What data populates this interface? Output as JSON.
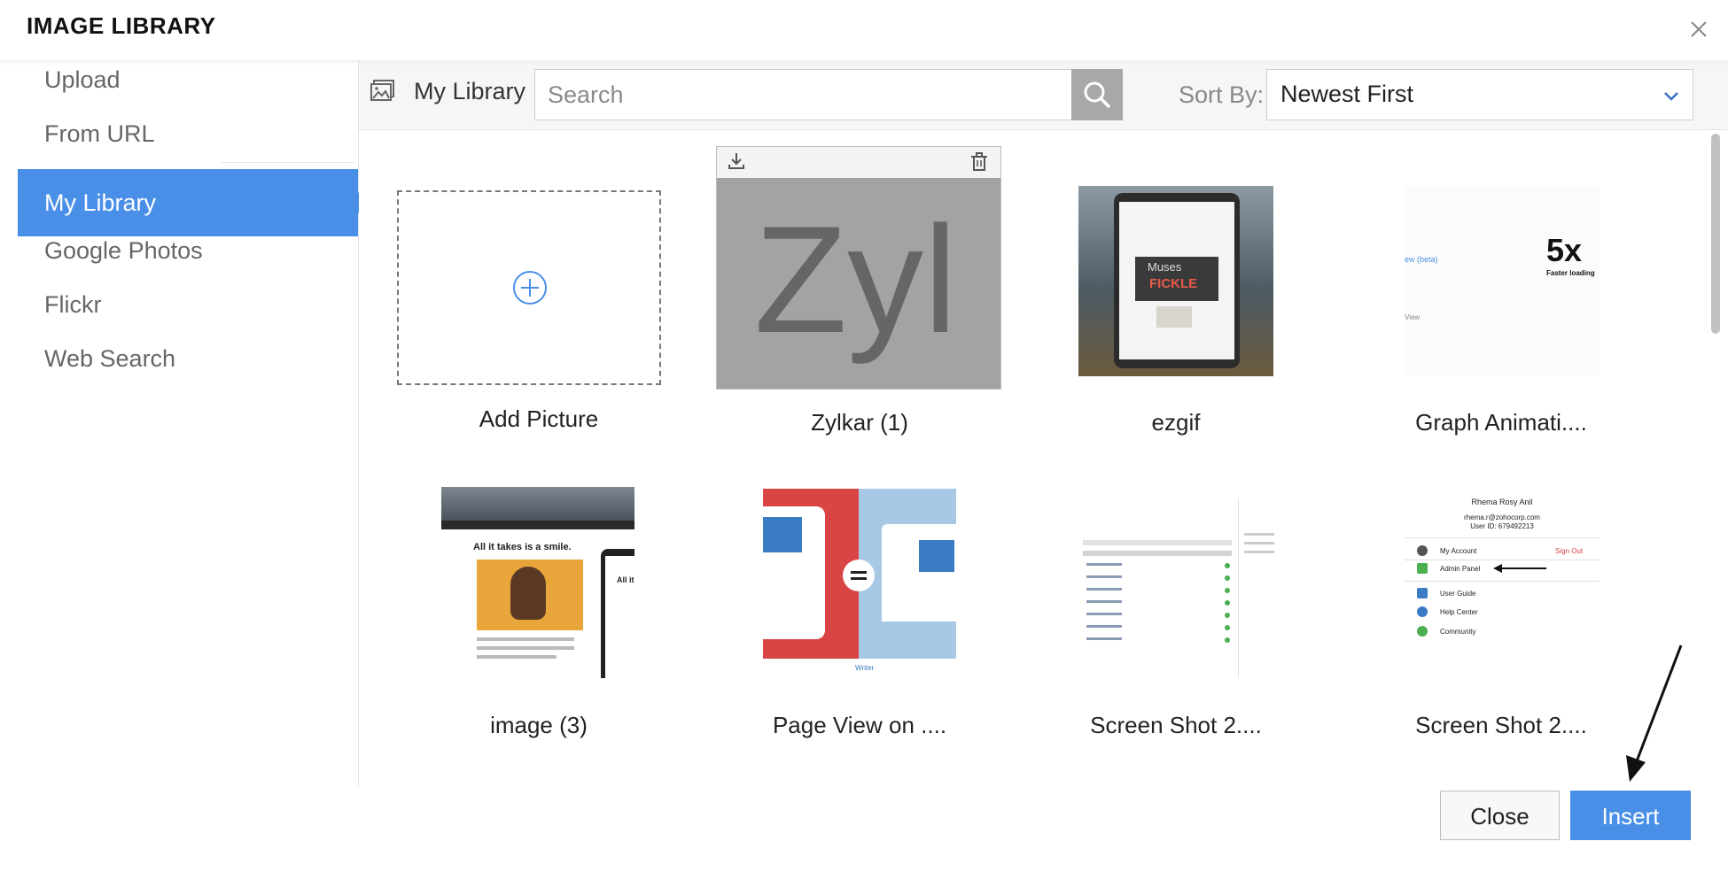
{
  "dialog": {
    "title": "IMAGE LIBRARY"
  },
  "sidebar": {
    "items": [
      {
        "label": "Upload"
      },
      {
        "label": "From URL"
      },
      {
        "label": "My Library"
      },
      {
        "label": "Google Photos"
      },
      {
        "label": "Flickr"
      },
      {
        "label": "Web Search"
      }
    ],
    "active": "My Library"
  },
  "toolbar": {
    "library_label": "My Library",
    "search_placeholder": "Search",
    "sort_label": "Sort By:",
    "sort_value": "Newest First"
  },
  "grid": {
    "add_label": "Add Picture",
    "items": [
      {
        "label": "Zylkar (1)",
        "thumb_text": "Zyl"
      },
      {
        "label": "ezgif",
        "thumb_text_1": "Muses",
        "thumb_text_2": "FICKLE"
      },
      {
        "label": "Graph Animati....",
        "thumb_text_1": "5x",
        "thumb_text_2": "Faster loading",
        "thumb_text_3": "ew (beta)",
        "thumb_text_4": "View"
      },
      {
        "label": "image (3)",
        "thumb_text_1": "All it takes is a smile.",
        "thumb_text_2": "All it"
      },
      {
        "label": "Page View on ....",
        "thumb_text": "Writer"
      },
      {
        "label": "Screen Shot 2...."
      },
      {
        "label": "Screen Shot 2....",
        "thumb_name": "Rhema Rosy Anil",
        "thumb_email": "rhema.r@zohocorp.com",
        "thumb_userid": "User ID: 679492213",
        "thumb_menu": [
          "My Account",
          "Admin Panel",
          "User Guide",
          "Help Center",
          "Community"
        ],
        "thumb_signout": "Sign Out"
      }
    ]
  },
  "footer": {
    "close_label": "Close",
    "insert_label": "Insert"
  },
  "colors": {
    "accent": "#4a8fe7",
    "search_button": "#a8a8a8"
  }
}
